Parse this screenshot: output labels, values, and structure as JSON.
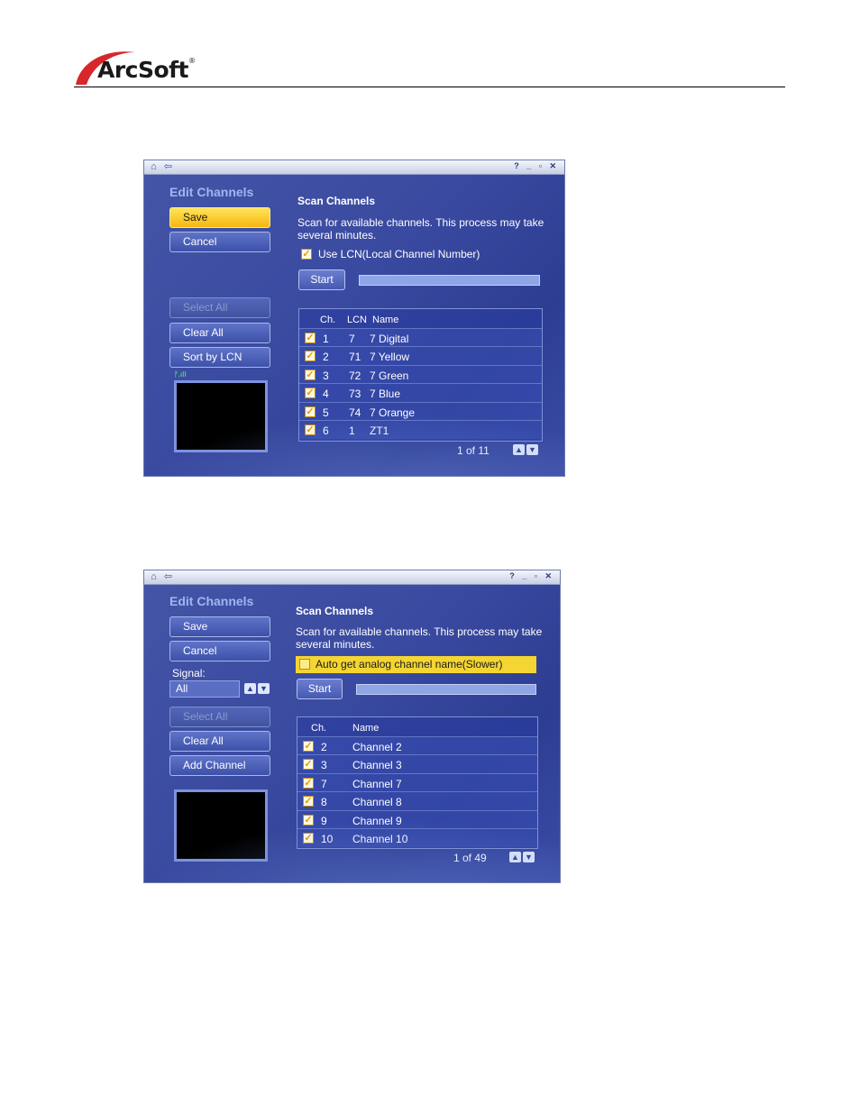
{
  "brand": {
    "logo_text": "ArcSoft",
    "trademark": "®"
  },
  "colors": {
    "accent_yellow": "#f7c20f",
    "window_blue": "#3a4aa0",
    "check_orange": "#e89a00",
    "signal_green": "#3ddc4f"
  },
  "window1": {
    "title_icons": [
      "home-icon",
      "back-icon"
    ],
    "window_controls": "? _ ▫ ✕",
    "edit_title": "Edit Channels",
    "buttons": {
      "save": "Save",
      "cancel": "Cancel",
      "select_all": "Select All",
      "clear_all": "Clear All",
      "sort_lcn": "Sort by LCN"
    },
    "signal_meter": "ᚠ.ıll",
    "scan_title": "Scan Channels",
    "scan_desc": "Scan for available channels. This process may take several minutes.",
    "option_label": "Use LCN(Local Channel Number)",
    "option_checked": true,
    "start": "Start",
    "columns": {
      "ch": "Ch.",
      "lcn": "LCN",
      "name": "Name"
    },
    "rows": [
      {
        "ch": "1",
        "lcn": "7",
        "name": "7 Digital"
      },
      {
        "ch": "2",
        "lcn": "71",
        "name": "7 Yellow"
      },
      {
        "ch": "3",
        "lcn": "72",
        "name": "7 Green"
      },
      {
        "ch": "4",
        "lcn": "73",
        "name": "7 Blue"
      },
      {
        "ch": "5",
        "lcn": "74",
        "name": "7 Orange"
      },
      {
        "ch": "6",
        "lcn": "1",
        "name": "ZT1"
      }
    ],
    "page": "1 of 11"
  },
  "window2": {
    "title_icons": [
      "home-icon",
      "back-icon"
    ],
    "window_controls": "? _ ▫ ✕",
    "edit_title": "Edit Channels",
    "buttons": {
      "save": "Save",
      "cancel": "Cancel",
      "select_all": "Select All",
      "clear_all": "Clear All",
      "add_channel": "Add Channel"
    },
    "signal_label": "Signal:",
    "signal_value": "All",
    "scan_title": "Scan Channels",
    "scan_desc": "Scan for available channels. This process may take several minutes.",
    "option_label": "Auto get analog channel name(Slower)",
    "option_checked": false,
    "start": "Start",
    "columns": {
      "ch": "Ch.",
      "name": "Name"
    },
    "rows": [
      {
        "ch": "2",
        "name": "Channel 2"
      },
      {
        "ch": "3",
        "name": "Channel 3"
      },
      {
        "ch": "7",
        "name": "Channel 7"
      },
      {
        "ch": "8",
        "name": "Channel 8"
      },
      {
        "ch": "9",
        "name": "Channel 9"
      },
      {
        "ch": "10",
        "name": "Channel 10"
      }
    ],
    "page": "1 of 49"
  }
}
